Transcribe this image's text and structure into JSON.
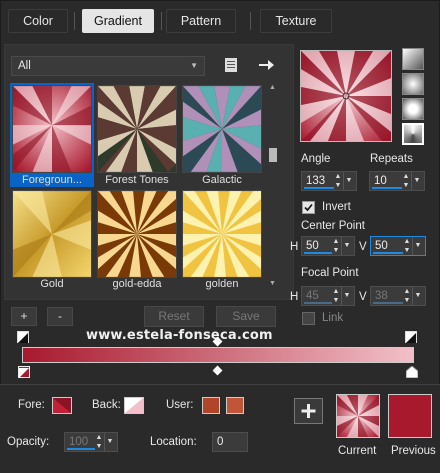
{
  "tabs": [
    {
      "label": "Color",
      "active": false
    },
    {
      "label": "Gradient",
      "active": true
    },
    {
      "label": "Pattern",
      "active": false
    },
    {
      "label": "Texture",
      "active": false
    }
  ],
  "category": {
    "value": "All"
  },
  "gradients": [
    {
      "name": "Foregroun...",
      "selected": true
    },
    {
      "name": "Forest Tones",
      "selected": false
    },
    {
      "name": "Galactic",
      "selected": false
    },
    {
      "name": "Gold",
      "selected": false
    },
    {
      "name": "gold-edda",
      "selected": false
    },
    {
      "name": "golden",
      "selected": false
    }
  ],
  "list_buttons": {
    "add": "+",
    "remove": "-",
    "reset": "Reset",
    "save": "Save"
  },
  "angle": {
    "label": "Angle",
    "value": "133"
  },
  "repeats": {
    "label": "Repeats",
    "value": "10"
  },
  "invert": {
    "label": "Invert",
    "checked": true
  },
  "center_point": {
    "label": "Center Point",
    "h_label": "H",
    "h_value": "50",
    "v_label": "V",
    "v_value": "50"
  },
  "focal_point": {
    "label": "Focal Point",
    "h_label": "H",
    "h_value": "45",
    "v_label": "V",
    "v_value": "38"
  },
  "link": {
    "label": "Link",
    "checked": false
  },
  "watermark": "www.estela-fonseca.com",
  "colors": {
    "accent": "#0a64c8",
    "foreground": "#a8192e",
    "background": "#f2c0c8",
    "user1": "#b0452a",
    "user2": "#c0553a",
    "panel": "#333333"
  },
  "bottom": {
    "fore_label": "Fore:",
    "back_label": "Back:",
    "user_label": "User:",
    "opacity_label": "Opacity:",
    "opacity_value": "100",
    "location_label": "Location:",
    "location_value": "0",
    "current_label": "Current",
    "previous_label": "Previous"
  }
}
